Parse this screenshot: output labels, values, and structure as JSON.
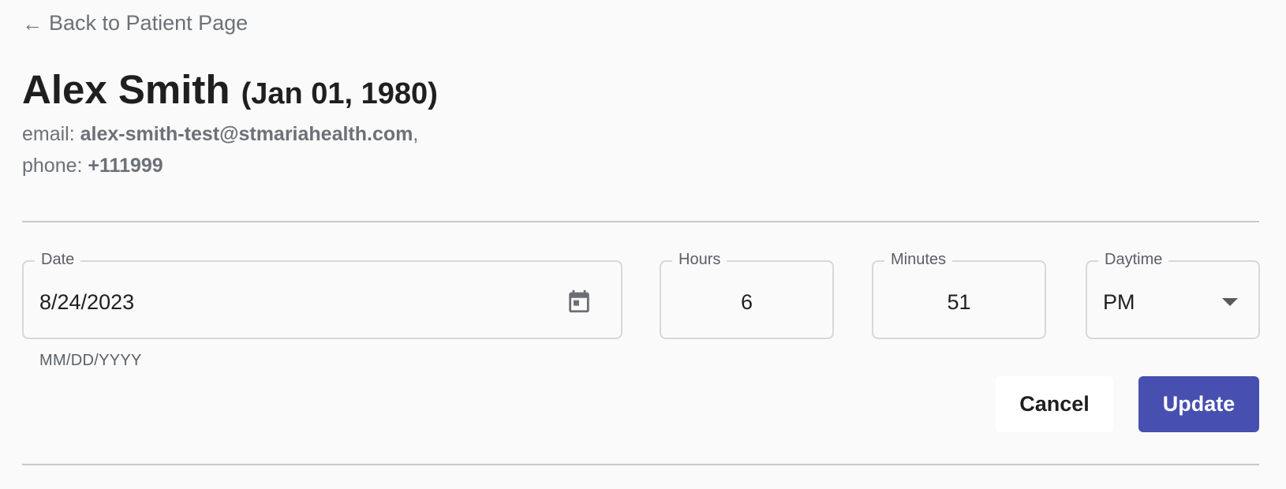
{
  "back_link": {
    "label": "Back to Patient Page",
    "icon": "arrow-left-icon"
  },
  "patient": {
    "name": "Alex Smith",
    "dob": "(Jan 01, 1980)",
    "email_label": "email: ",
    "email": "alex-smith-test@stmariahealth.com",
    "email_suffix": ",",
    "phone_label": "phone: ",
    "phone": "+111999"
  },
  "form": {
    "date": {
      "label": "Date",
      "value": "8/24/2023",
      "helper": "MM/DD/YYYY",
      "icon": "calendar-icon"
    },
    "hours": {
      "label": "Hours",
      "value": "6"
    },
    "minutes": {
      "label": "Minutes",
      "value": "51"
    },
    "daytime": {
      "label": "Daytime",
      "value": "PM",
      "icon": "chevron-down-icon"
    }
  },
  "actions": {
    "cancel_label": "Cancel",
    "update_label": "Update",
    "update_color": "#4750b0"
  },
  "colors": {
    "background": "#fafafa",
    "muted_text": "#6b7178",
    "primary": "#4750b0"
  }
}
